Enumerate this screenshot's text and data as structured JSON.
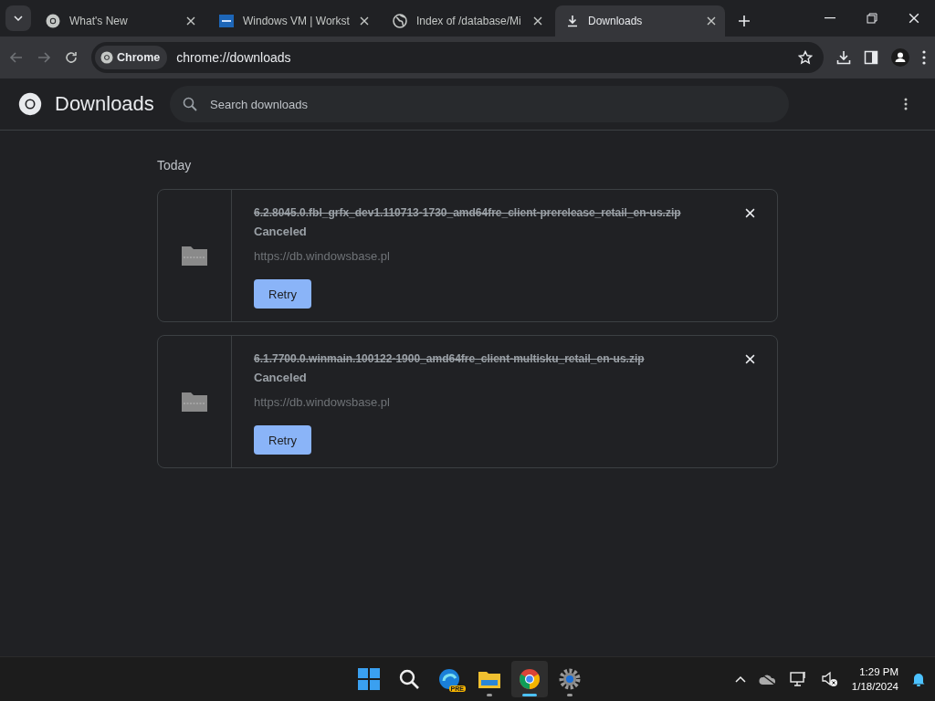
{
  "tabs": [
    {
      "title": "What's New",
      "kind": "chrome",
      "selected": false
    },
    {
      "title": "Windows VM | Workst",
      "kind": "vmw",
      "selected": false
    },
    {
      "title": "Index of /database/Mi",
      "kind": "globe",
      "selected": false
    },
    {
      "title": "Downloads",
      "kind": "download",
      "selected": true
    }
  ],
  "omnibox": {
    "chip": "Chrome",
    "url": "chrome://downloads"
  },
  "page": {
    "title": "Downloads",
    "search": {
      "placeholder": "Search downloads"
    },
    "section": "Today"
  },
  "downloads": [
    {
      "filename": "6.2.8045.0.fbl_grfx_dev1.110713-1730_amd64fre_client-prerelease_retail_en-us.zip",
      "canceled": true,
      "status": "Canceled",
      "url": "https://db.windowsbase.pl",
      "button": "Retry"
    },
    {
      "filename": "6.1.7700.0.winmain.100122-1900_amd64fre_client-multisku_retail_en-us.zip",
      "canceled": true,
      "status": "Canceled",
      "url": "https://db.windowsbase.pl",
      "button": "Retry"
    }
  ],
  "taskbar": {
    "apps": [
      {
        "kind": "start",
        "open": false,
        "selected": false
      },
      {
        "kind": "search",
        "open": false,
        "selected": false
      },
      {
        "kind": "edge",
        "badge": "PRE",
        "open": false,
        "selected": false
      },
      {
        "kind": "folder",
        "open": true,
        "selected": false
      },
      {
        "kind": "chrome",
        "open": true,
        "selected": true
      },
      {
        "kind": "settings",
        "open": true,
        "selected": false
      }
    ],
    "time": "1:29 PM",
    "date": "1/18/2024"
  }
}
